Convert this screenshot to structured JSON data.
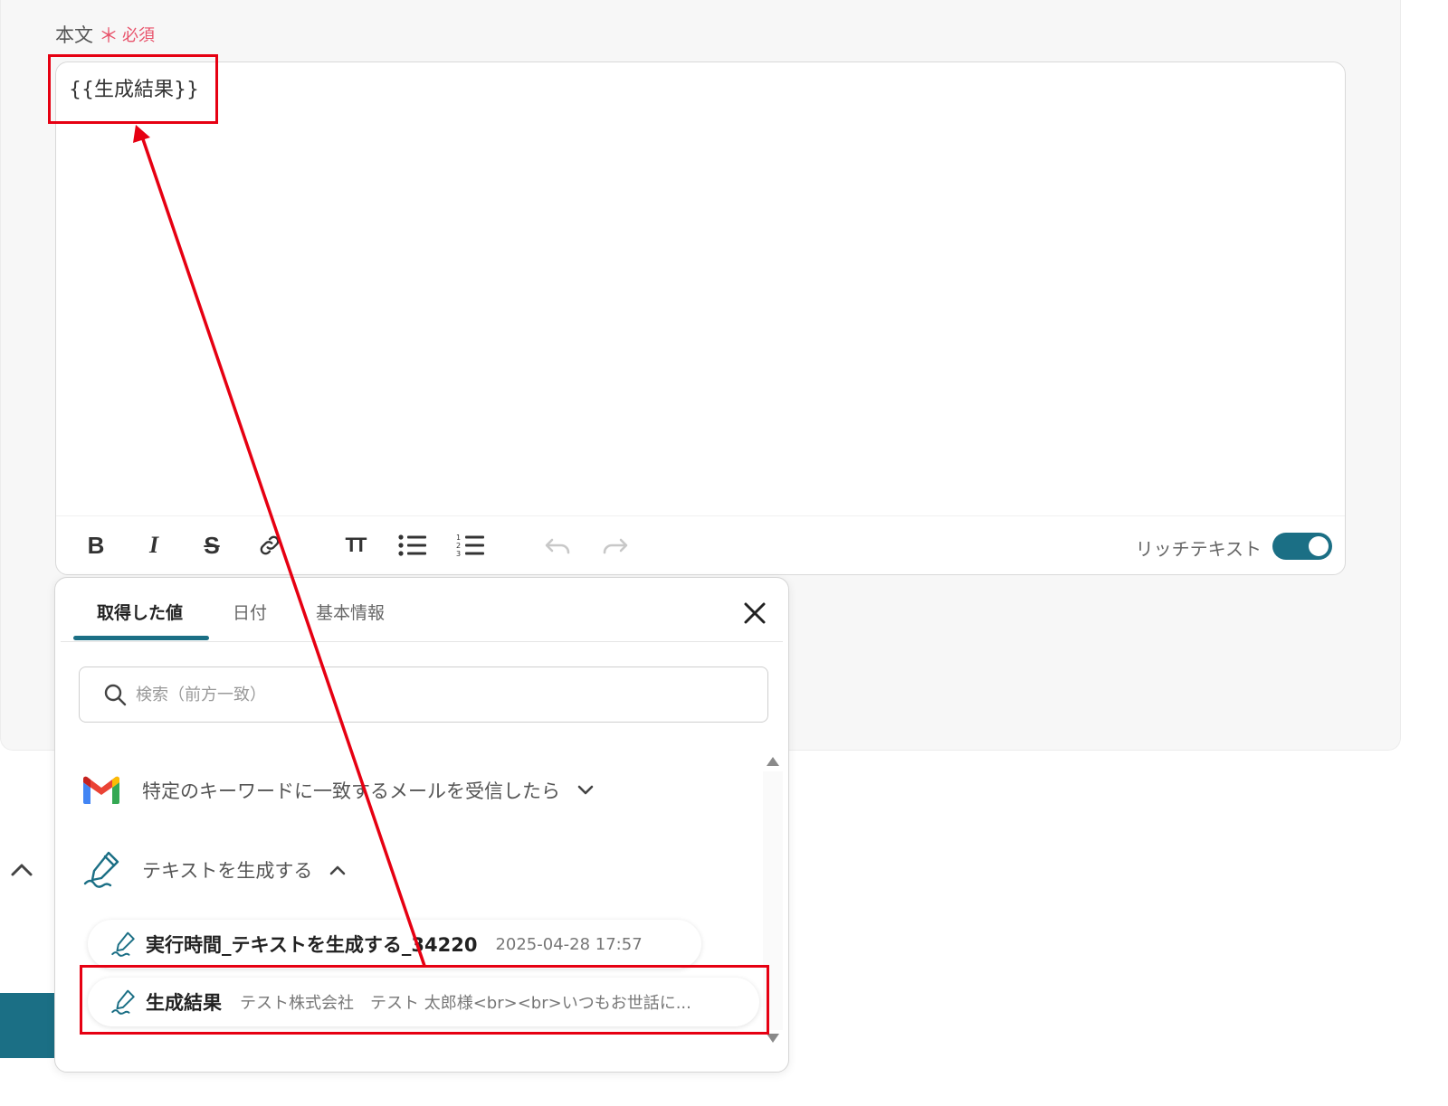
{
  "field": {
    "label": "本文",
    "required_star": "＊",
    "required_text": "必須",
    "value": "{{生成結果}}"
  },
  "toolbar": {
    "bold_label": "B",
    "italic_label": "I",
    "strike_label": "S",
    "font_size_label": "TT",
    "rich_text_label": "リッチテキスト",
    "rich_text_enabled": true
  },
  "popover": {
    "tabs": [
      {
        "label": "取得した値",
        "active": true
      },
      {
        "label": "日付",
        "active": false
      },
      {
        "label": "基本情報",
        "active": false
      }
    ],
    "search": {
      "placeholder": "検索（前方一致）",
      "value": ""
    },
    "groups": [
      {
        "label": "特定のキーワードに一致するメールを受信したら",
        "icon": "gmail-icon",
        "expanded": false
      },
      {
        "label": "テキストを生成する",
        "icon": "ai-pen-icon",
        "expanded": true
      }
    ],
    "items": [
      {
        "title": "実行時間_テキストを生成する_34220",
        "value": "2025-04-28 17:57"
      },
      {
        "title": "生成結果",
        "value": "テスト株式会社　テスト 太郎様<br><br>いつもお世話に..."
      }
    ]
  },
  "colors": {
    "accent": "#1b6f85",
    "required": "#e8536b",
    "annotation": "#e60012"
  }
}
